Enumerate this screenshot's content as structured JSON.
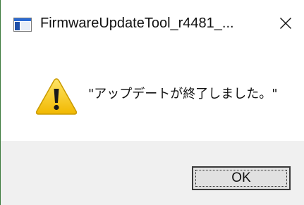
{
  "window": {
    "title": "FirmwareUpdateTool_r4481_...",
    "app_icon": "window-app-icon",
    "close_icon": "close-icon",
    "close_glyph": "✕"
  },
  "message": {
    "icon": "warning-icon",
    "text": "\"アップデートが終了しました。\""
  },
  "buttons": {
    "ok_label": "OK"
  },
  "colors": {
    "dialog_bg": "#ffffff",
    "footer_bg": "#f0f0f0",
    "button_bg": "#e1e1e1",
    "warning_yellow": "#f5c400"
  }
}
